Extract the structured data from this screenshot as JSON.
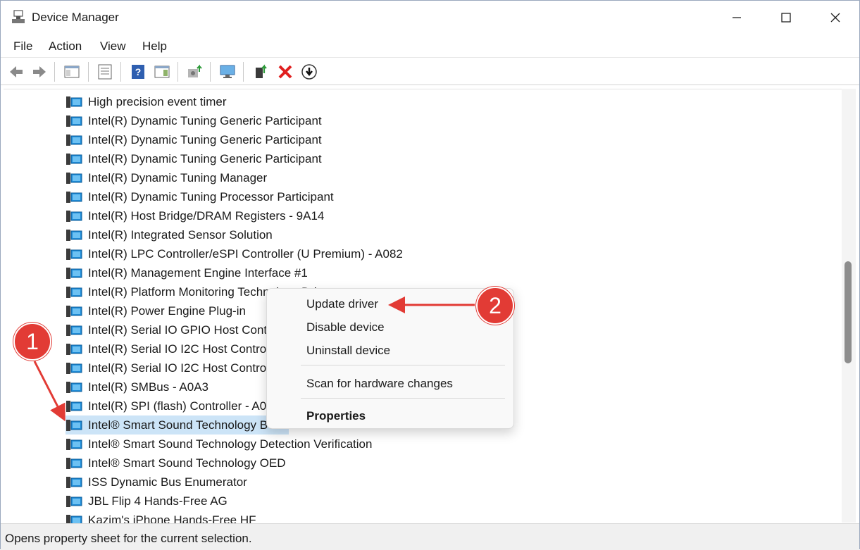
{
  "window": {
    "title": "Device Manager",
    "title_icon": "device-manager-icon"
  },
  "menu": [
    "File",
    "Action",
    "View",
    "Help"
  ],
  "toolbar": [
    "back-icon",
    "forward-icon",
    "show-hide-console-tree-icon",
    "properties-icon",
    "help-icon",
    "action-pane-icon",
    "update-driver-icon",
    "scan-hardware-icon",
    "enable-device-icon",
    "uninstall-icon",
    "download-icon"
  ],
  "devices": [
    "High precision event timer",
    "Intel(R) Dynamic Tuning Generic Participant",
    "Intel(R) Dynamic Tuning Generic Participant",
    "Intel(R) Dynamic Tuning Generic Participant",
    "Intel(R) Dynamic Tuning Manager",
    "Intel(R) Dynamic Tuning Processor Participant",
    "Intel(R) Host Bridge/DRAM Registers - 9A14",
    "Intel(R) Integrated Sensor Solution",
    "Intel(R) LPC Controller/eSPI Controller (U Premium) - A082",
    "Intel(R) Management Engine Interface #1",
    "Intel(R) Platform Monitoring Technology Driver",
    "Intel(R) Power Engine Plug-in",
    "Intel(R) Serial IO GPIO Host Controller",
    "Intel(R) Serial IO I2C Host Controller",
    "Intel(R) Serial IO I2C Host Controller",
    "Intel(R) SMBus - A0A3",
    "Intel(R) SPI (flash) Controller - A0A4",
    "Intel® Smart Sound Technology BUS",
    "Intel® Smart Sound Technology Detection Verification",
    "Intel® Smart Sound Technology OED",
    "ISS Dynamic Bus Enumerator",
    "JBL Flip 4 Hands-Free AG",
    "Kazim's iPhone Hands-Free HF"
  ],
  "context_menu": {
    "update_driver": "Update driver",
    "disable_device": "Disable device",
    "uninstall_device": "Uninstall device",
    "scan_hardware": "Scan for hardware changes",
    "properties": "Properties"
  },
  "annotations": {
    "step1": "1",
    "step2": "2",
    "color": "#e23b35"
  },
  "status": "Opens property sheet for the current selection."
}
